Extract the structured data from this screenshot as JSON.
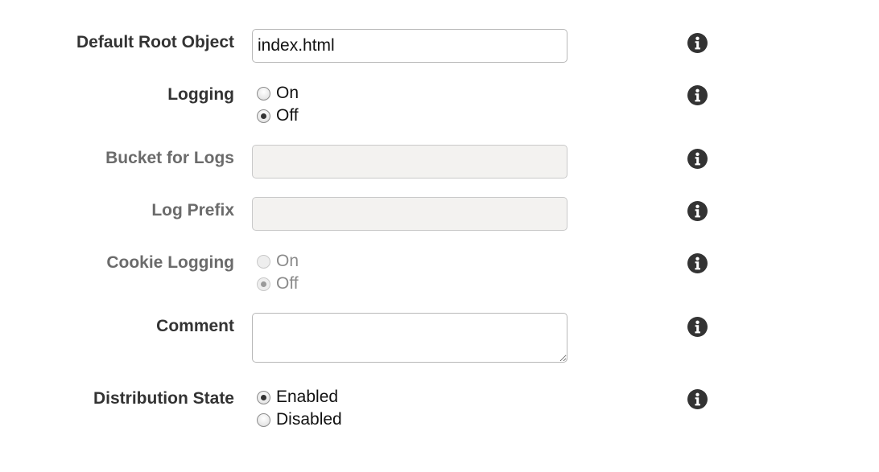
{
  "fields": {
    "default_root_object": {
      "label": "Default Root Object",
      "value": "index.html"
    },
    "logging": {
      "label": "Logging",
      "options": [
        "On",
        "Off"
      ],
      "selected": "Off"
    },
    "bucket_for_logs": {
      "label": "Bucket for Logs",
      "value": ""
    },
    "log_prefix": {
      "label": "Log Prefix",
      "value": ""
    },
    "cookie_logging": {
      "label": "Cookie Logging",
      "options": [
        "On",
        "Off"
      ],
      "selected": "Off"
    },
    "comment": {
      "label": "Comment",
      "value": ""
    },
    "distribution_state": {
      "label": "Distribution State",
      "options": [
        "Enabled",
        "Disabled"
      ],
      "selected": "Enabled"
    }
  },
  "icons": {
    "info": "info-icon"
  },
  "colors": {
    "label": "#333333",
    "label_disabled": "#6b6b6b",
    "input_disabled_bg": "#f3f2f0",
    "info_icon": "#333333"
  }
}
